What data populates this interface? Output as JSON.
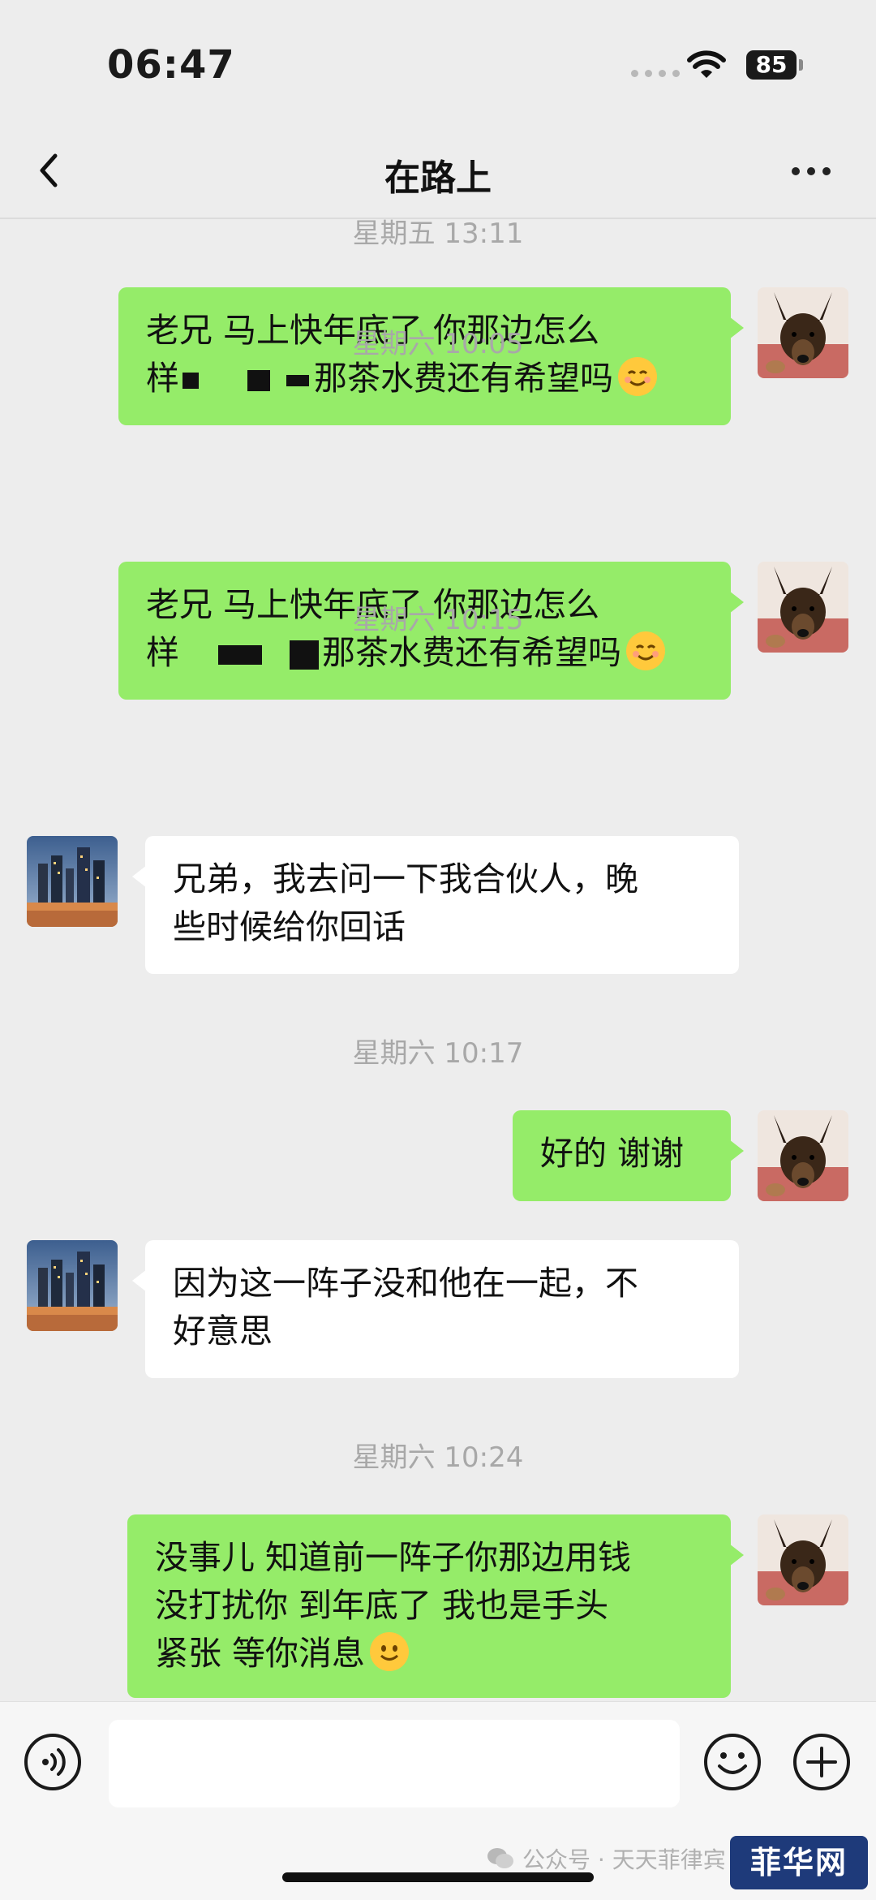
{
  "status_bar": {
    "time": "06:47",
    "battery": "85"
  },
  "nav": {
    "title": "在路上",
    "back_icon": "chevron-left-icon",
    "more_icon": "more-dots-icon"
  },
  "messages": {
    "ts1": "星期五 13:11",
    "m1": {
      "line1": "老兄 马上快年底了 你那边怎么",
      "line2_prefix": "样",
      "line2_suffix": "那茶水费还有希望吗"
    },
    "ts2": "星期六 10:05",
    "m2": {
      "line1": "老兄 马上快年底了 你那边怎么",
      "line2_prefix": "样",
      "line2_suffix": "那茶水费还有希望吗"
    },
    "ts3": "星期六 10:15",
    "m3": {
      "line1": "兄弟，我去问一下我合伙人，晚",
      "line2": "些时候给你回话"
    },
    "ts4": "星期六 10:17",
    "m4": {
      "line1": "好的 谢谢"
    },
    "m5": {
      "line1": "因为这一阵子没和他在一起，不",
      "line2": "好意思"
    },
    "ts5": "星期六 10:24",
    "m6": {
      "line1": "没事儿 知道前一阵子你那边用钱",
      "line2": "没打扰你 到年底了 我也是手头",
      "line3": "紧张 等你消息"
    }
  },
  "input_bar": {
    "voice_icon": "voice-icon",
    "emoji_icon": "emoji-icon",
    "plus_icon": "plus-icon",
    "input_value": ""
  },
  "watermark": {
    "text": "公众号 · 天天菲律宾"
  },
  "logo": {
    "text": "菲华网"
  },
  "colors": {
    "outgoing_bubble": "#95ec69",
    "incoming_bubble": "#ffffff",
    "background": "#ededed"
  }
}
